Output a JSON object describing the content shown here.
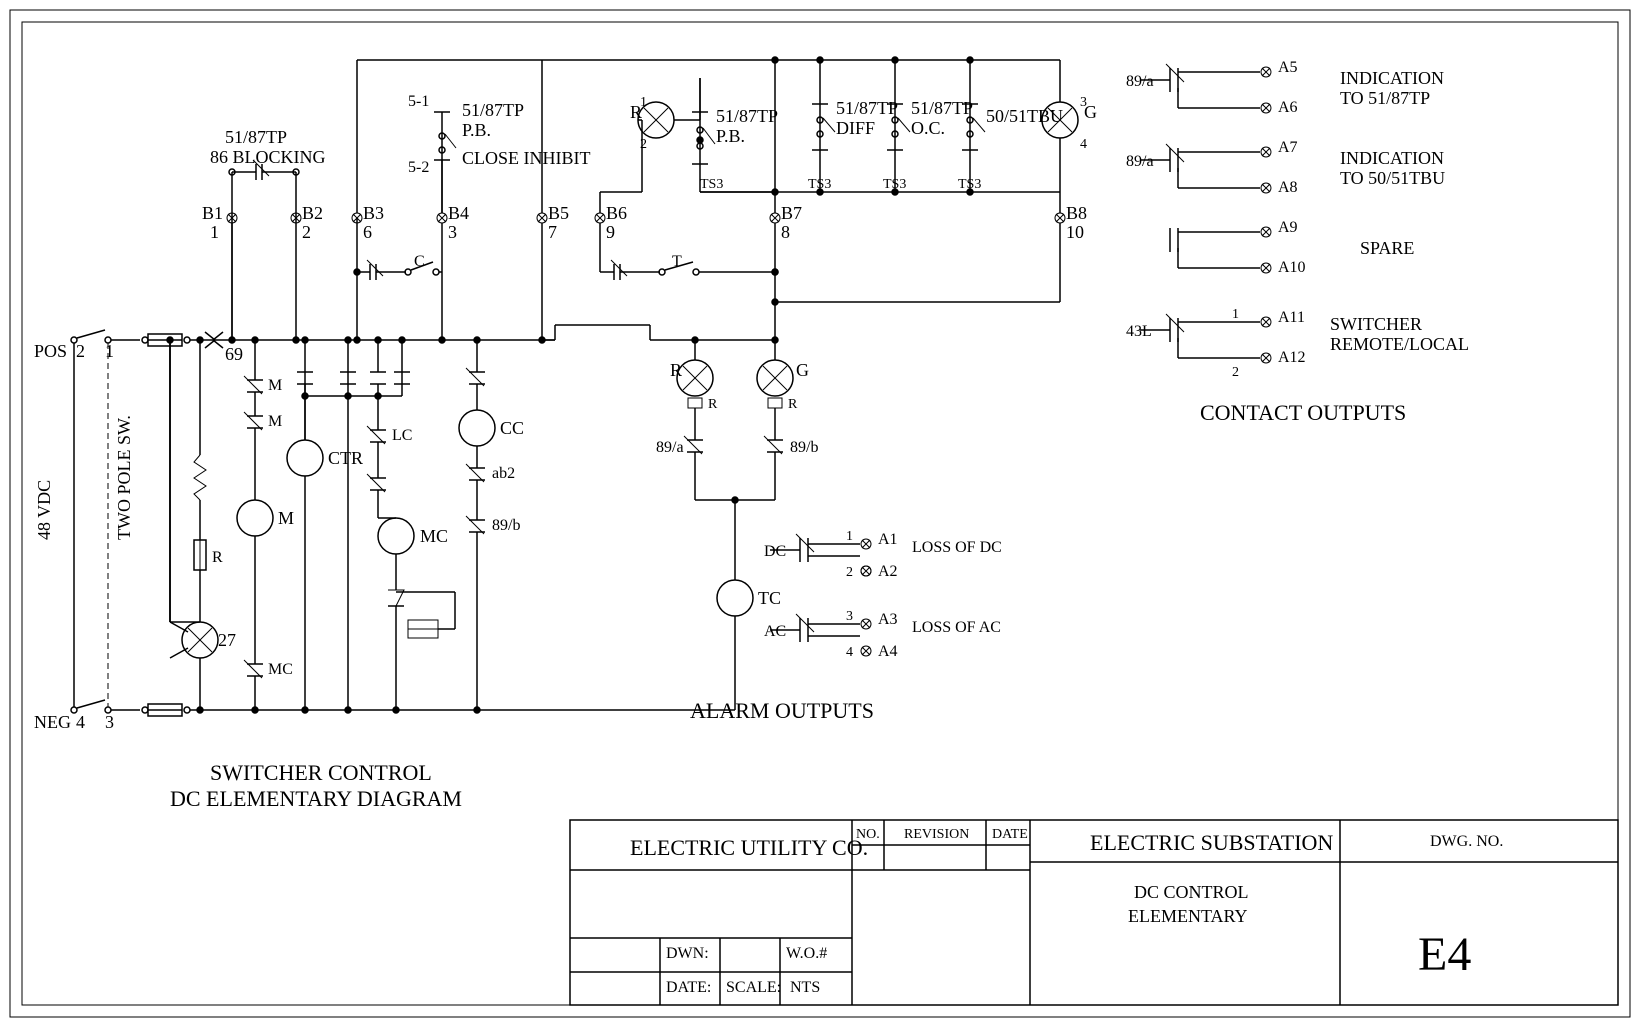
{
  "left_bus_label": "48 VDC",
  "two_pole": "TWO POLE SW.",
  "pos": "POS",
  "pos_n": [
    "2",
    "1"
  ],
  "neg": "NEG",
  "neg_n": [
    "4",
    "3"
  ],
  "sw69": "69",
  "blocking": [
    "51/87TP",
    "86 BLOCKING"
  ],
  "close_inhibit": "CLOSE INHIBIT",
  "pb1": [
    "51/87TP",
    "P.B."
  ],
  "pb1_terms": [
    "5-1",
    "5-2"
  ],
  "pb2": [
    "51/87TP",
    "P.B."
  ],
  "diff": [
    "51/87TP",
    "DIFF"
  ],
  "oc": [
    "51/87TP",
    "O.C."
  ],
  "tbu": "50/51TBU",
  "ts3": "TS3",
  "R_lamp": "R",
  "G_lamp": "G",
  "terminals_B": [
    "B1",
    "1",
    "B2",
    "2",
    "B3",
    "6",
    "B4",
    "3",
    "B5",
    "7",
    "B6",
    "9",
    "B7",
    "8",
    "B8",
    "10"
  ],
  "C_contact": "C",
  "T_contact": "T",
  "coils": {
    "CTR": "CTR",
    "M": "M",
    "MC": "MC",
    "CC": "CC",
    "LC": "LC",
    "TC": "TC",
    "27": "27"
  },
  "contacts": {
    "M": "M",
    "R_res": "R",
    "MC": "MC",
    "ab2": "ab2",
    "89a": "89/a",
    "89b": "89/b"
  },
  "lamp_R": "R",
  "lamp_G": "G",
  "res_R": "R",
  "alarm_title": "ALARM OUTPUTS",
  "alarm": {
    "DC": "DC",
    "AC": "AC",
    "loss_dc": "LOSS OF DC",
    "loss_ac": "LOSS OF AC",
    "A": [
      "A1",
      "A2",
      "A3",
      "A4"
    ],
    "n": [
      "1",
      "2",
      "3",
      "4"
    ]
  },
  "contact_title": "CONTACT OUTPUTS",
  "outputs": [
    {
      "sw": "89/a",
      "t": [
        "A5",
        "A6"
      ],
      "lbl": [
        "INDICATION",
        "TO 51/87TP"
      ]
    },
    {
      "sw": "89/a",
      "t": [
        "A7",
        "A8"
      ],
      "lbl": [
        "INDICATION",
        "TO 50/51TBU"
      ]
    },
    {
      "sw": "",
      "t": [
        "A9",
        "A10"
      ],
      "lbl": [
        "SPARE",
        ""
      ]
    },
    {
      "sw": "43L",
      "t": [
        "A11",
        "A12"
      ],
      "lbl": [
        "SWITCHER",
        "REMOTE/LOCAL"
      ],
      "n": [
        "1",
        "2"
      ]
    }
  ],
  "diagram_caption": [
    "SWITCHER CONTROL",
    "DC ELEMENTARY DIAGRAM"
  ],
  "titleblock": {
    "company": "ELECTRIC UTILITY CO.",
    "no": "NO.",
    "rev": "REVISION",
    "date": "DATE",
    "dwn": "DWN:",
    "wo": "W.O.#",
    "date2": "DATE:",
    "scale": "SCALE:",
    "nts": "NTS",
    "t1": "ELECTRIC SUBSTATION",
    "t2": "DC CONTROL",
    "t3": "ELEMENTARY",
    "dwg": "DWG. NO.",
    "eno": "E4"
  }
}
